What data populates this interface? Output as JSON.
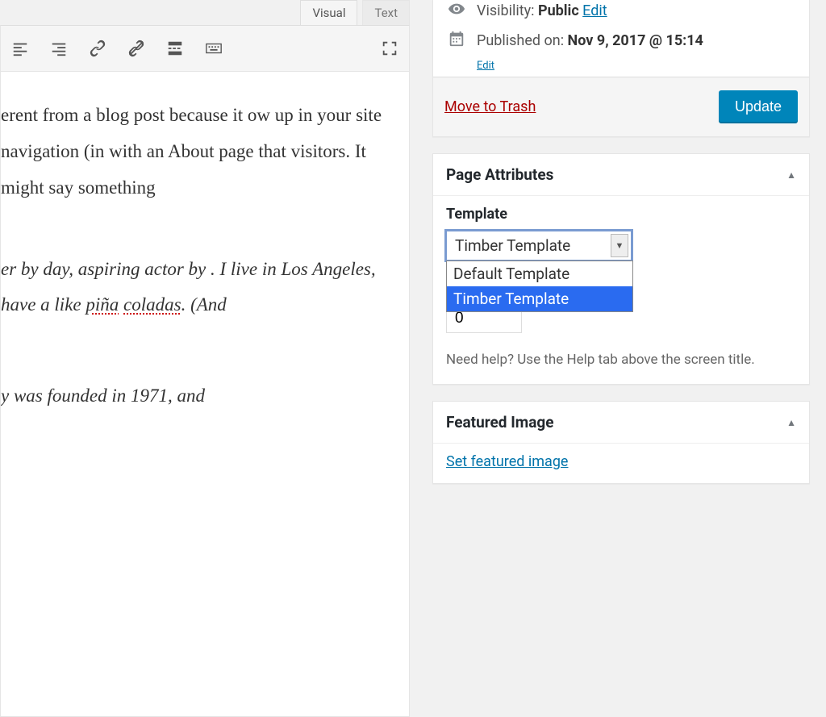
{
  "editor": {
    "tabs": {
      "visual": "Visual",
      "text": "Text"
    },
    "content_para1": "erent from a blog post because it ow up in your site navigation (in with an About page that visitors. It might say something",
    "content_quote": "er by day, aspiring actor by . I live in Los Angeles, have a like piña coladas. (And",
    "spell1": "piña",
    "spell2": "coladas",
    "content_para2": "y was founded in 1971, and"
  },
  "publish": {
    "visibility_label": "Visibility:",
    "visibility_value": "Public",
    "visibility_edit": "Edit",
    "published_label": "Published on:",
    "published_value": "Nov 9, 2017 @ 15:14",
    "published_edit": "Edit",
    "trash": "Move to Trash",
    "update": "Update"
  },
  "page_attributes": {
    "title": "Page Attributes",
    "template_label": "Template",
    "selected": "Timber Template",
    "options": [
      "Default Template",
      "Timber Template"
    ],
    "order_value": "0",
    "help_text": "Need help? Use the Help tab above the screen title."
  },
  "featured_image": {
    "title": "Featured Image",
    "link": "Set featured image"
  }
}
